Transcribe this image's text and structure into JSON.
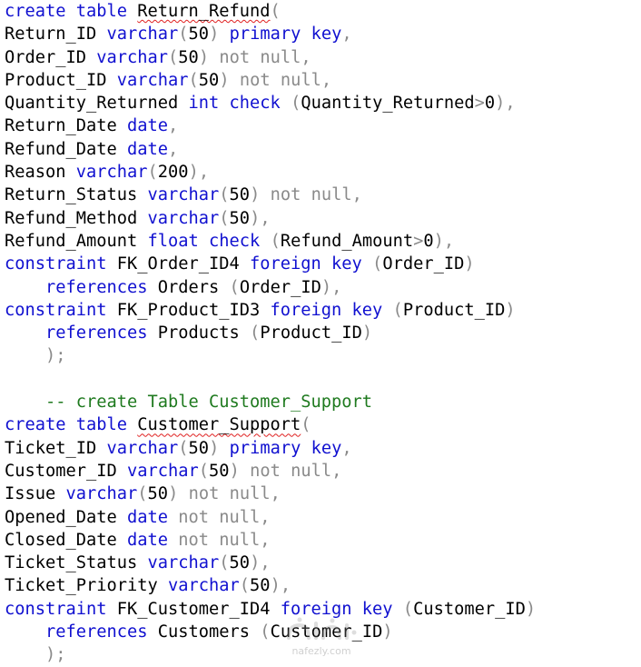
{
  "editor": {
    "language": "SQL",
    "colors": {
      "keyword": "#1010d0",
      "operator_gray": "#8a8a8a",
      "comment": "#1f7a1f",
      "identifier": "#000000",
      "squiggle": "#e02020"
    },
    "lines": [
      [
        {
          "t": "create table",
          "c": "kw"
        },
        {
          "t": " "
        },
        {
          "t": "Return_Refund",
          "sq": true
        },
        {
          "t": "(",
          "c": "gray"
        }
      ],
      [
        {
          "t": "Return_ID "
        },
        {
          "t": "varchar",
          "c": "kw"
        },
        {
          "t": "(",
          "c": "gray"
        },
        {
          "t": "50"
        },
        {
          "t": ")",
          "c": "gray"
        },
        {
          "t": " "
        },
        {
          "t": "primary key",
          "c": "kw"
        },
        {
          "t": ",",
          "c": "gray"
        }
      ],
      [
        {
          "t": "Order_ID "
        },
        {
          "t": "varchar",
          "c": "kw"
        },
        {
          "t": "(",
          "c": "gray"
        },
        {
          "t": "50"
        },
        {
          "t": ") not null,",
          "c": "gray"
        }
      ],
      [
        {
          "t": "Product_ID "
        },
        {
          "t": "varchar",
          "c": "kw"
        },
        {
          "t": "(",
          "c": "gray"
        },
        {
          "t": "50"
        },
        {
          "t": ") not null,",
          "c": "gray"
        }
      ],
      [
        {
          "t": "Quantity_Returned "
        },
        {
          "t": "int",
          "c": "kw"
        },
        {
          "t": " "
        },
        {
          "t": "check",
          "c": "kw"
        },
        {
          "t": " (",
          "c": "gray"
        },
        {
          "t": "Quantity_Returned"
        },
        {
          "t": ">",
          "c": "gray"
        },
        {
          "t": "0"
        },
        {
          "t": "),",
          "c": "gray"
        }
      ],
      [
        {
          "t": "Return_Date "
        },
        {
          "t": "date",
          "c": "kw"
        },
        {
          "t": ",",
          "c": "gray"
        }
      ],
      [
        {
          "t": "Refund_Date "
        },
        {
          "t": "date",
          "c": "kw"
        },
        {
          "t": ",",
          "c": "gray"
        }
      ],
      [
        {
          "t": "Reason "
        },
        {
          "t": "varchar",
          "c": "kw"
        },
        {
          "t": "(",
          "c": "gray"
        },
        {
          "t": "200"
        },
        {
          "t": "),",
          "c": "gray"
        }
      ],
      [
        {
          "t": "Return_Status "
        },
        {
          "t": "varchar",
          "c": "kw"
        },
        {
          "t": "(",
          "c": "gray"
        },
        {
          "t": "50"
        },
        {
          "t": ") not null,",
          "c": "gray"
        }
      ],
      [
        {
          "t": "Refund_Method "
        },
        {
          "t": "varchar",
          "c": "kw"
        },
        {
          "t": "(",
          "c": "gray"
        },
        {
          "t": "50"
        },
        {
          "t": "),",
          "c": "gray"
        }
      ],
      [
        {
          "t": "Refund_Amount "
        },
        {
          "t": "float",
          "c": "kw"
        },
        {
          "t": " "
        },
        {
          "t": "check",
          "c": "kw"
        },
        {
          "t": " (",
          "c": "gray"
        },
        {
          "t": "Refund_Amount"
        },
        {
          "t": ">",
          "c": "gray"
        },
        {
          "t": "0"
        },
        {
          "t": "),",
          "c": "gray"
        }
      ],
      [
        {
          "t": "constraint",
          "c": "kw"
        },
        {
          "t": " FK_Order_ID4 "
        },
        {
          "t": "foreign key",
          "c": "kw"
        },
        {
          "t": " (",
          "c": "gray"
        },
        {
          "t": "Order_ID"
        },
        {
          "t": ")",
          "c": "gray"
        }
      ],
      [
        {
          "t": "    "
        },
        {
          "t": "references",
          "c": "kw"
        },
        {
          "t": " Orders "
        },
        {
          "t": "(",
          "c": "gray"
        },
        {
          "t": "Order_ID"
        },
        {
          "t": "),",
          "c": "gray"
        }
      ],
      [
        {
          "t": "constraint",
          "c": "kw"
        },
        {
          "t": " FK_Product_ID3 "
        },
        {
          "t": "foreign key",
          "c": "kw"
        },
        {
          "t": " (",
          "c": "gray"
        },
        {
          "t": "Product_ID"
        },
        {
          "t": ")",
          "c": "gray"
        }
      ],
      [
        {
          "t": "    "
        },
        {
          "t": "references",
          "c": "kw"
        },
        {
          "t": " Products "
        },
        {
          "t": "(",
          "c": "gray"
        },
        {
          "t": "Product_ID"
        },
        {
          "t": ")",
          "c": "gray"
        }
      ],
      [
        {
          "t": "    "
        },
        {
          "t": ");",
          "c": "gray"
        }
      ],
      [],
      [
        {
          "t": "    "
        },
        {
          "t": "-- create Table Customer_Support",
          "c": "cmt"
        }
      ],
      [
        {
          "t": "create table",
          "c": "kw"
        },
        {
          "t": " "
        },
        {
          "t": "Customer_Support",
          "sq": true
        },
        {
          "t": "(",
          "c": "gray"
        }
      ],
      [
        {
          "t": "Ticket_ID "
        },
        {
          "t": "varchar",
          "c": "kw"
        },
        {
          "t": "(",
          "c": "gray"
        },
        {
          "t": "50"
        },
        {
          "t": ")",
          "c": "gray"
        },
        {
          "t": " "
        },
        {
          "t": "primary key",
          "c": "kw"
        },
        {
          "t": ",",
          "c": "gray"
        }
      ],
      [
        {
          "t": "Customer_ID "
        },
        {
          "t": "varchar",
          "c": "kw"
        },
        {
          "t": "(",
          "c": "gray"
        },
        {
          "t": "50"
        },
        {
          "t": ") not null,",
          "c": "gray"
        }
      ],
      [
        {
          "t": "Issue "
        },
        {
          "t": "varchar",
          "c": "kw"
        },
        {
          "t": "(",
          "c": "gray"
        },
        {
          "t": "50"
        },
        {
          "t": ") not null,",
          "c": "gray"
        }
      ],
      [
        {
          "t": "Opened_Date "
        },
        {
          "t": "date",
          "c": "kw"
        },
        {
          "t": " not null,",
          "c": "gray"
        }
      ],
      [
        {
          "t": "Closed_Date "
        },
        {
          "t": "date",
          "c": "kw"
        },
        {
          "t": " not null,",
          "c": "gray"
        }
      ],
      [
        {
          "t": "Ticket_Status "
        },
        {
          "t": "varchar",
          "c": "kw"
        },
        {
          "t": "(",
          "c": "gray"
        },
        {
          "t": "50"
        },
        {
          "t": "),",
          "c": "gray"
        }
      ],
      [
        {
          "t": "Ticket_Priority "
        },
        {
          "t": "varchar",
          "c": "kw"
        },
        {
          "t": "(",
          "c": "gray"
        },
        {
          "t": "50"
        },
        {
          "t": "),",
          "c": "gray"
        }
      ],
      [
        {
          "t": "constraint",
          "c": "kw"
        },
        {
          "t": " FK_Customer_ID4 "
        },
        {
          "t": "foreign key",
          "c": "kw"
        },
        {
          "t": " (",
          "c": "gray"
        },
        {
          "t": "Customer_ID"
        },
        {
          "t": ")",
          "c": "gray"
        }
      ],
      [
        {
          "t": "    "
        },
        {
          "t": "references",
          "c": "kw"
        },
        {
          "t": " Customers "
        },
        {
          "t": "(",
          "c": "gray"
        },
        {
          "t": "Customer_ID"
        },
        {
          "t": ")",
          "c": "gray"
        }
      ],
      [
        {
          "t": "    "
        },
        {
          "t": ");",
          "c": "gray"
        }
      ]
    ]
  },
  "watermark": {
    "text": "nafezly.com",
    "icon": "nafezly-logo-icon"
  }
}
